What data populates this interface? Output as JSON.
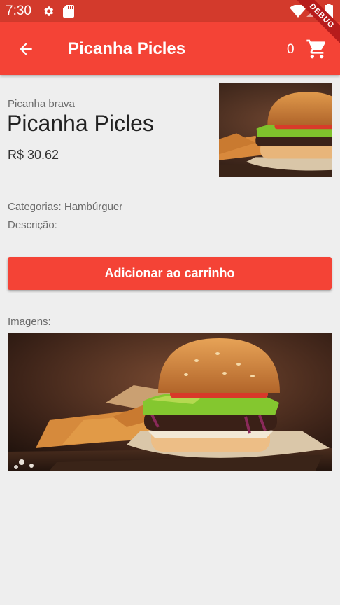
{
  "status_bar": {
    "time": "7:30",
    "icons": [
      "gear-icon",
      "sd-card-icon",
      "wifi-icon",
      "signal-icon",
      "battery-icon"
    ],
    "color": "#d33a2c"
  },
  "debug_banner": "DEBUG",
  "app_bar": {
    "title": "Picanha Picles",
    "cart_count": "0",
    "back_icon": "arrow-back-icon",
    "cart_icon": "shopping-cart-icon",
    "color": "#f44336"
  },
  "product": {
    "subtitle": "Picanha brava",
    "name": "Picanha Picles",
    "price": "R$ 30.62",
    "categories": "Categorias: Hambúrguer",
    "description": "Descrição:"
  },
  "actions": {
    "add_to_cart": "Adicionar ao carrinho"
  },
  "gallery": {
    "label": "Imagens:"
  }
}
